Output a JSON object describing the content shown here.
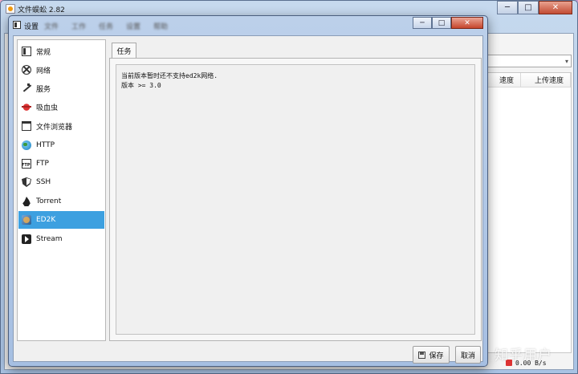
{
  "main_window": {
    "title": "文件蜈蚣 2.82",
    "controls": {
      "minimize": "─",
      "maximize": "□",
      "close": "✕"
    },
    "menu_blurred": [
      "文件",
      "工作",
      "任务",
      "设置",
      "帮助"
    ],
    "combo_arrow": "▾",
    "table_headers": [
      "速度",
      "上传速度"
    ],
    "status_text": "0.00 B/s",
    "watermark": "知乎用户"
  },
  "dialog": {
    "title": "设置",
    "menu_blurred": [
      "文件",
      "工作",
      "任务",
      "设置",
      "帮助"
    ],
    "controls": {
      "minimize": "─",
      "maximize": "□",
      "close": "✕"
    },
    "sidebar_items": [
      {
        "label": "常规",
        "icon": "general-icon"
      },
      {
        "label": "网络",
        "icon": "network-icon"
      },
      {
        "label": "服务",
        "icon": "service-icon"
      },
      {
        "label": "吸血虫",
        "icon": "vampire-icon"
      },
      {
        "label": "文件浏览器",
        "icon": "folder-icon"
      },
      {
        "label": "HTTP",
        "icon": "globe-icon"
      },
      {
        "label": "FTP",
        "icon": "ftp-icon"
      },
      {
        "label": "SSH",
        "icon": "shield-icon"
      },
      {
        "label": "Torrent",
        "icon": "flame-icon"
      },
      {
        "label": "ED2K",
        "icon": "ed2k-icon"
      },
      {
        "label": "Stream",
        "icon": "play-icon"
      }
    ],
    "active_item": "ED2K",
    "tab_label": "任务",
    "message_lines": [
      "当前版本暂时还不支持ed2k网络.",
      "版本 >= 3.0"
    ],
    "save_label": "保存",
    "cancel_label": "取消"
  }
}
